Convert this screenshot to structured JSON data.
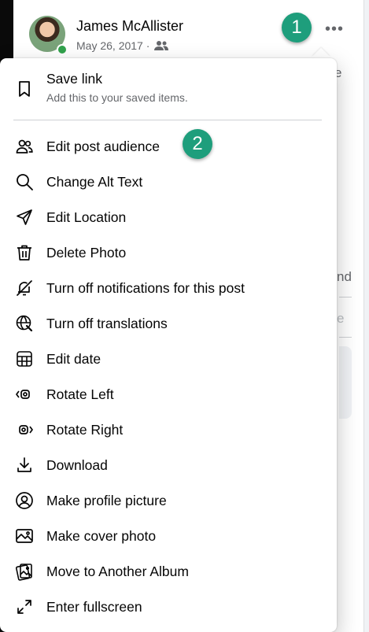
{
  "post": {
    "author": "James McAllister",
    "date": "May 26, 2017 ·",
    "audience_icon": "friends-icon",
    "more_icon": "•••"
  },
  "badges": {
    "one": "1",
    "two": "2"
  },
  "background_text": {
    "right_e": "e",
    "right_nd": "nd",
    "right_e2": "e"
  },
  "menu": {
    "save": {
      "title": "Save link",
      "subtitle": "Add this to your saved items."
    },
    "items": [
      {
        "label": "Edit post audience",
        "icon": "people-icon"
      },
      {
        "label": "Change Alt Text",
        "icon": "search-icon"
      },
      {
        "label": "Edit Location",
        "icon": "location-arrow-icon"
      },
      {
        "label": "Delete Photo",
        "icon": "trash-icon"
      },
      {
        "label": "Turn off notifications for this post",
        "icon": "bell-off-icon"
      },
      {
        "label": "Turn off translations",
        "icon": "globe-translate-icon"
      },
      {
        "label": "Edit date",
        "icon": "calendar-icon"
      },
      {
        "label": "Rotate Left",
        "icon": "rotate-left-icon"
      },
      {
        "label": "Rotate Right",
        "icon": "rotate-right-icon"
      },
      {
        "label": "Download",
        "icon": "download-icon"
      },
      {
        "label": "Make profile picture",
        "icon": "profile-circle-icon"
      },
      {
        "label": "Make cover photo",
        "icon": "image-icon"
      },
      {
        "label": "Move to Another Album",
        "icon": "album-icon"
      },
      {
        "label": "Enter fullscreen",
        "icon": "expand-icon"
      }
    ]
  }
}
